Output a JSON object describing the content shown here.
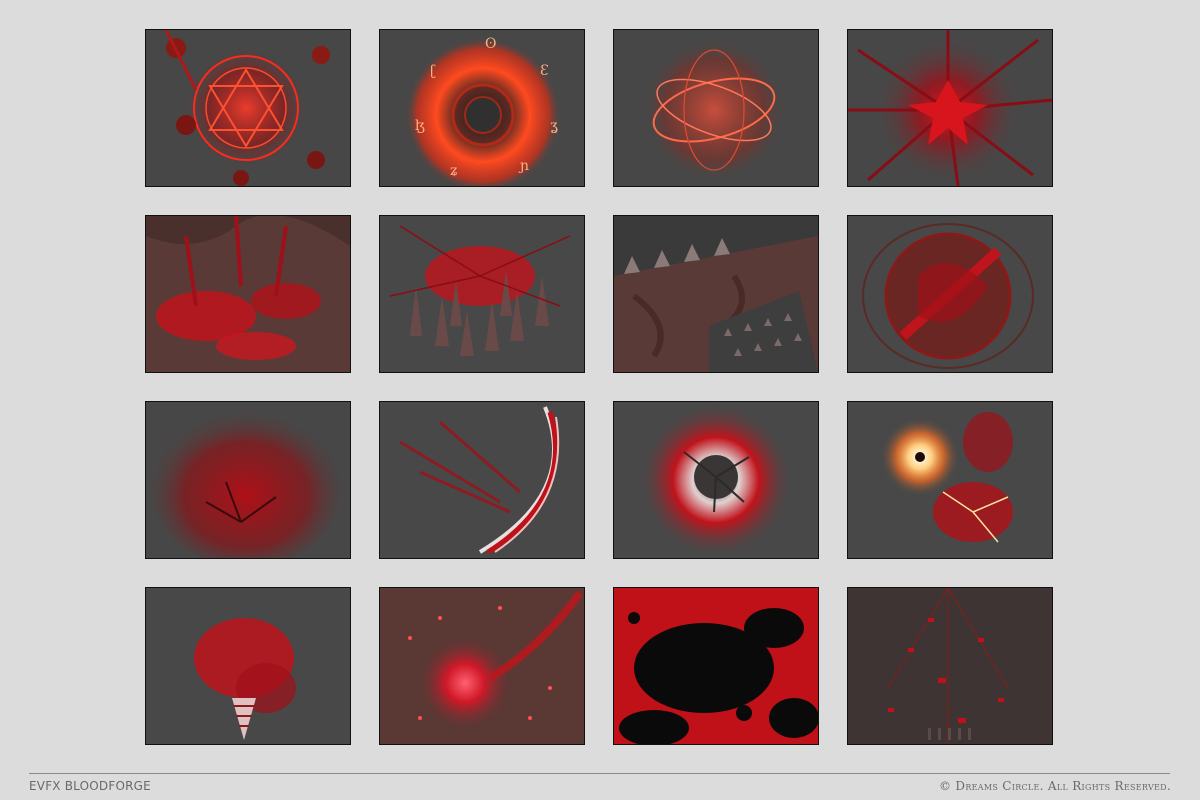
{
  "gallery": {
    "thumbnails": [
      {
        "label": "",
        "icon": "summoning-circle-icon"
      },
      {
        "label": "",
        "icon": "rune-portal-icon"
      },
      {
        "label": "",
        "icon": "rune-sphere-icon"
      },
      {
        "label": "",
        "icon": "blood-burst-icon"
      },
      {
        "label": "",
        "icon": "blood-ground-splatter-icon"
      },
      {
        "label": "",
        "icon": "blood-spikes-icon"
      },
      {
        "label": "",
        "icon": "spike-wall-icon"
      },
      {
        "label": "",
        "icon": "blood-orb-icon"
      },
      {
        "label": "",
        "icon": "blood-cloud-icon"
      },
      {
        "label": "",
        "icon": "blood-slash-icon"
      },
      {
        "label": "",
        "icon": "spiked-explosion-icon"
      },
      {
        "label": "",
        "icon": "fire-blood-explosion-icon"
      },
      {
        "label": "",
        "icon": "blood-drill-icon"
      },
      {
        "label": "",
        "icon": "blood-nova-icon"
      },
      {
        "label": "",
        "icon": "blood-splash-screen-icon"
      },
      {
        "label": "",
        "icon": "blood-rain-icon"
      }
    ]
  },
  "footer": {
    "product": "EVFX BLOODFORGE",
    "copyright": "© Dreams Circle. All Rights Reserved."
  },
  "colors": {
    "background": "#dcdcdc",
    "thumb_bg": "#474747",
    "blood": "#c8141e",
    "glow": "#ff4a2a"
  }
}
